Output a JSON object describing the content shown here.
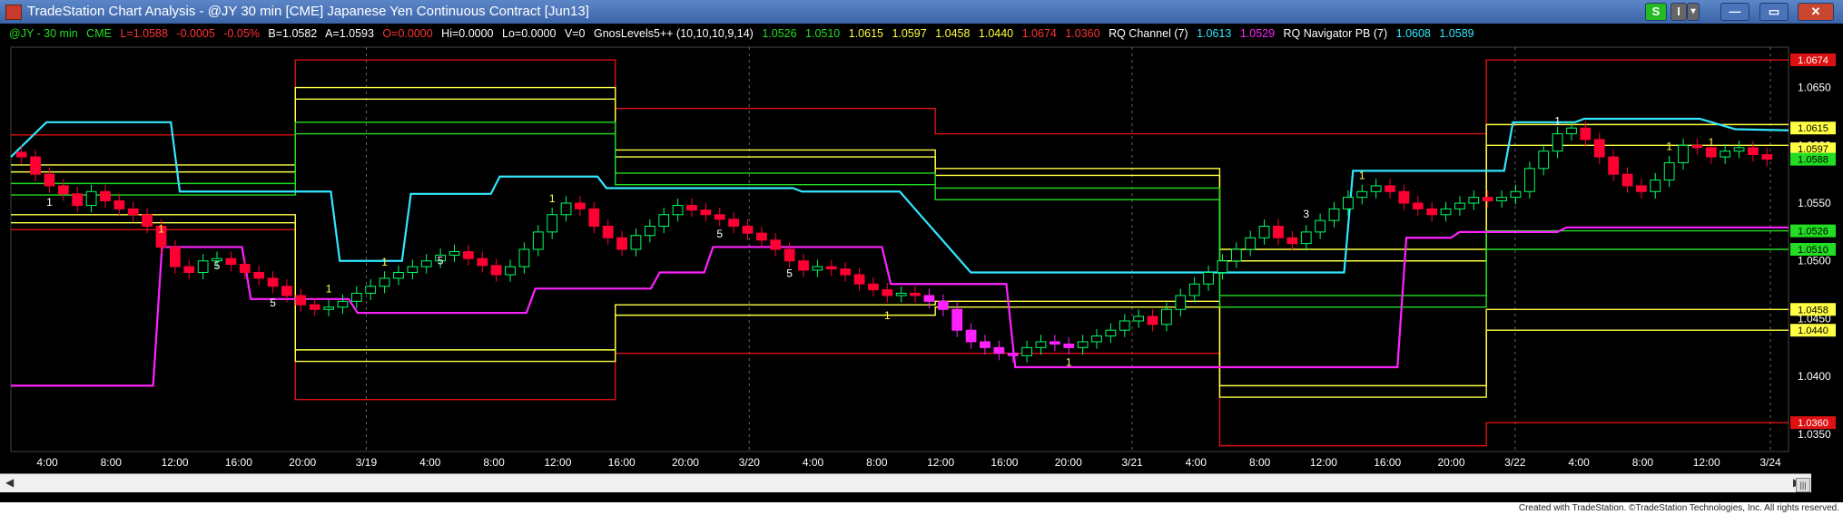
{
  "window": {
    "title": "TradeStation Chart Analysis - @JY 30 min [CME] Japanese Yen Continuous Contract [Jun13]",
    "buttons": [
      "S",
      "I",
      "▾",
      "—",
      "▭",
      "✕"
    ]
  },
  "legend": {
    "symbol": "@JY - 30 min",
    "exchange": "CME",
    "last": "L=1.0588",
    "change": "-0.0005",
    "change_pct": "-0.05%",
    "bid": "B=1.0582",
    "ask": "A=1.0593",
    "open": "O=0.0000",
    "high": "Hi=0.0000",
    "low": "Lo=0.0000",
    "volume": "V=0",
    "study1": "GnosLevels5++ (10,10,10,9,14)",
    "study1_vals": [
      "1.0526",
      "1.0510",
      "1.0615",
      "1.0597",
      "1.0458",
      "1.0440",
      "1.0674",
      "1.0360"
    ],
    "study2": "RQ  Channel (7)",
    "study2_vals": [
      "1.0613",
      "1.0529"
    ],
    "study3": "RQ Navigator PB (7)",
    "study3_vals": [
      "1.0608",
      "1.0589"
    ]
  },
  "colors": {
    "background": "#000000",
    "up_candle": "#00ff66",
    "down_candle": "#ff0033",
    "cyan": "#33e6ff",
    "magenta": "#ff22ff",
    "yellow": "#ffff44",
    "green": "#22dd22",
    "red": "#dd1111"
  },
  "chart_data": {
    "type": "candlestick",
    "x_tick_labels": [
      "4:00",
      "8:00",
      "12:00",
      "16:00",
      "20:00",
      "3/19",
      "4:00",
      "8:00",
      "12:00",
      "16:00",
      "20:00",
      "3/20",
      "4:00",
      "8:00",
      "12:00",
      "16:00",
      "20:00",
      "3/21",
      "4:00",
      "8:00",
      "12:00",
      "16:00",
      "20:00",
      "3/22",
      "4:00",
      "8:00",
      "12:00",
      "3/24"
    ],
    "y_tick_labels": [
      "1.0650",
      "1.0600",
      "1.0550",
      "1.0500",
      "1.0450",
      "1.0400",
      "1.0350"
    ],
    "ylim": [
      1.0335,
      1.0685
    ],
    "price_tags": [
      {
        "label": "1.0674",
        "value": 1.0674,
        "color": "#dd1111",
        "text": "#ffffff"
      },
      {
        "label": "1.0615",
        "value": 1.0615,
        "color": "#ffff44",
        "text": "#000000"
      },
      {
        "label": "1.0597",
        "value": 1.0597,
        "color": "#ffff44",
        "text": "#000000"
      },
      {
        "label": "1.0588",
        "value": 1.0588,
        "color": "#22dd22",
        "text": "#000000"
      },
      {
        "label": "1.0526",
        "value": 1.0526,
        "color": "#22dd22",
        "text": "#000000"
      },
      {
        "label": "1.0510",
        "value": 1.051,
        "color": "#22dd22",
        "text": "#000000"
      },
      {
        "label": "1.0458",
        "value": 1.0458,
        "color": "#ffff44",
        "text": "#000000"
      },
      {
        "label": "1.0440",
        "value": 1.044,
        "color": "#ffff44",
        "text": "#000000"
      },
      {
        "label": "1.0360",
        "value": 1.036,
        "color": "#dd1111",
        "text": "#ffffff"
      }
    ],
    "level_series": [
      {
        "color": "#dd1111",
        "segments": [
          [
            0,
            16,
            1.0609
          ],
          [
            16,
            34,
            1.0674
          ],
          [
            34,
            52,
            1.0632
          ],
          [
            52,
            68,
            1.061
          ],
          [
            68,
            83,
            1.061
          ],
          [
            83,
            100,
            1.0674
          ]
        ]
      },
      {
        "color": "#dd1111",
        "segments": [
          [
            0,
            16,
            1.0527
          ],
          [
            16,
            34,
            1.038
          ],
          [
            34,
            52,
            1.042
          ],
          [
            52,
            68,
            1.042
          ],
          [
            68,
            83,
            1.034
          ],
          [
            83,
            100,
            1.036
          ]
        ]
      },
      {
        "color": "#ffff44",
        "segments": [
          [
            0,
            16,
            1.0583
          ],
          [
            16,
            34,
            1.065
          ],
          [
            34,
            52,
            1.0596
          ],
          [
            52,
            68,
            1.058
          ],
          [
            68,
            83,
            1.051
          ],
          [
            83,
            100,
            1.0618
          ]
        ]
      },
      {
        "color": "#ffff44",
        "segments": [
          [
            0,
            16,
            1.0577
          ],
          [
            16,
            34,
            1.064
          ],
          [
            34,
            52,
            1.059
          ],
          [
            52,
            68,
            1.0574
          ],
          [
            68,
            83,
            1.05
          ],
          [
            83,
            100,
            1.06
          ]
        ]
      },
      {
        "color": "#ffff44",
        "segments": [
          [
            0,
            16,
            1.054
          ],
          [
            16,
            34,
            1.0423
          ],
          [
            34,
            52,
            1.0462
          ],
          [
            52,
            68,
            1.0465
          ],
          [
            68,
            83,
            1.0392
          ],
          [
            83,
            100,
            1.0458
          ]
        ]
      },
      {
        "color": "#ffff44",
        "segments": [
          [
            0,
            16,
            1.0533
          ],
          [
            16,
            34,
            1.0413
          ],
          [
            34,
            52,
            1.0453
          ],
          [
            52,
            68,
            1.046
          ],
          [
            68,
            83,
            1.0382
          ],
          [
            83,
            100,
            1.044
          ]
        ]
      },
      {
        "color": "#22dd22",
        "segments": [
          [
            0,
            16,
            1.0567
          ],
          [
            16,
            34,
            1.062
          ],
          [
            34,
            52,
            1.0576
          ],
          [
            52,
            68,
            1.0563
          ],
          [
            68,
            83,
            1.047
          ],
          [
            83,
            100,
            1.0526
          ]
        ]
      },
      {
        "color": "#22dd22",
        "segments": [
          [
            0,
            16,
            1.0557
          ],
          [
            16,
            34,
            1.061
          ],
          [
            34,
            52,
            1.0566
          ],
          [
            52,
            68,
            1.0553
          ],
          [
            68,
            83,
            1.046
          ],
          [
            83,
            100,
            1.051
          ]
        ]
      }
    ],
    "channel_upper": [
      [
        0,
        1.059
      ],
      [
        2,
        1.062
      ],
      [
        9,
        1.062
      ],
      [
        9.5,
        1.056
      ],
      [
        18,
        1.056
      ],
      [
        18.5,
        1.05
      ],
      [
        22,
        1.05
      ],
      [
        22.5,
        1.0558
      ],
      [
        27,
        1.0558
      ],
      [
        27.5,
        1.0573
      ],
      [
        33,
        1.0573
      ],
      [
        33.5,
        1.0563
      ],
      [
        44,
        1.0563
      ],
      [
        44.5,
        1.056
      ],
      [
        50,
        1.056
      ],
      [
        54,
        1.049
      ],
      [
        75,
        1.049
      ],
      [
        75.5,
        1.0578
      ],
      [
        84,
        1.0578
      ],
      [
        84.5,
        1.062
      ],
      [
        88,
        1.062
      ],
      [
        88.5,
        1.0623
      ],
      [
        95,
        1.0623
      ],
      [
        97,
        1.0614
      ],
      [
        100,
        1.0613
      ]
    ],
    "channel_lower": [
      [
        0,
        1.058
      ],
      [
        2,
        1.058
      ],
      [
        2.5,
        1.058
      ]
    ],
    "navigator": [
      [
        0,
        1.0392
      ],
      [
        8,
        1.0392
      ],
      [
        8.5,
        1.0512
      ],
      [
        13,
        1.0512
      ],
      [
        13.5,
        1.0467
      ],
      [
        19,
        1.0467
      ],
      [
        19.5,
        1.0455
      ],
      [
        29,
        1.0455
      ],
      [
        29.5,
        1.0476
      ],
      [
        36,
        1.0476
      ],
      [
        36.5,
        1.049
      ],
      [
        39,
        1.049
      ],
      [
        39.5,
        1.0512
      ],
      [
        49,
        1.0512
      ],
      [
        49.5,
        1.048
      ],
      [
        56,
        1.048
      ],
      [
        56.5,
        1.0408
      ],
      [
        78,
        1.0408
      ],
      [
        78.5,
        1.052
      ],
      [
        81,
        1.052
      ],
      [
        81.5,
        1.0525
      ],
      [
        87,
        1.0525
      ],
      [
        87.5,
        1.0529
      ],
      [
        100,
        1.0529
      ]
    ],
    "candles_close": [
      1.059,
      1.0575,
      1.0565,
      1.0558,
      1.0548,
      1.056,
      1.0552,
      1.0545,
      1.054,
      1.053,
      1.0512,
      1.0495,
      1.049,
      1.05,
      1.0502,
      1.0497,
      1.049,
      1.0485,
      1.0478,
      1.047,
      1.0462,
      1.0458,
      1.046,
      1.0465,
      1.0472,
      1.0478,
      1.0485,
      1.049,
      1.0495,
      1.05,
      1.0505,
      1.0508,
      1.0502,
      1.0496,
      1.0488,
      1.0495,
      1.051,
      1.0525,
      1.054,
      1.055,
      1.0545,
      1.053,
      1.052,
      1.051,
      1.0522,
      1.053,
      1.054,
      1.0548,
      1.0544,
      1.054,
      1.0536,
      1.053,
      1.0524,
      1.0518,
      1.051,
      1.05,
      1.0492,
      1.0495,
      1.0493,
      1.0488,
      1.048,
      1.0475,
      1.047,
      1.0472,
      1.047,
      1.0465,
      1.0458,
      1.044,
      1.043,
      1.0425,
      1.042,
      1.0418,
      1.0425,
      1.043,
      1.0428,
      1.0425,
      1.043,
      1.0435,
      1.044,
      1.0448,
      1.0452,
      1.0445,
      1.0458,
      1.047,
      1.048,
      1.049,
      1.05,
      1.051,
      1.052,
      1.053,
      1.052,
      1.0515,
      1.0525,
      1.0535,
      1.0545,
      1.0555,
      1.056,
      1.0565,
      1.056,
      1.055,
      1.0545,
      1.054,
      1.0545,
      1.055,
      1.0555,
      1.0552,
      1.0555,
      1.056,
      1.058,
      1.0595,
      1.061,
      1.0615,
      1.0605,
      1.059,
      1.0575,
      1.0565,
      1.056,
      1.057,
      1.0585,
      1.06,
      1.0598,
      1.059,
      1.0595,
      1.0598,
      1.0592,
      1.0588
    ],
    "annotations": [
      {
        "text": "1",
        "i": 2,
        "color": "#ffffff",
        "dy": 22
      },
      {
        "text": "1",
        "i": 10,
        "color": "#ffff44",
        "dy": -16
      },
      {
        "text": "5",
        "i": 14,
        "color": "#ffffff",
        "dy": 12
      },
      {
        "text": "5",
        "i": 18,
        "color": "#ffffff",
        "dy": 22
      },
      {
        "text": "1",
        "i": 22,
        "color": "#ffff44",
        "dy": -16
      },
      {
        "text": "1",
        "i": 26,
        "color": "#ffff44",
        "dy": -14
      },
      {
        "text": "5",
        "i": 30,
        "color": "#ffffff",
        "dy": 10
      },
      {
        "text": "1",
        "i": 38,
        "color": "#ffff44",
        "dy": -14
      },
      {
        "text": "5",
        "i": 50,
        "color": "#ffffff",
        "dy": 20
      },
      {
        "text": "5",
        "i": 55,
        "color": "#ffffff",
        "dy": 18
      },
      {
        "text": "1",
        "i": 62,
        "color": "#ffff44",
        "dy": 26
      },
      {
        "text": "1",
        "i": 75,
        "color": "#ffff44",
        "dy": 20
      },
      {
        "text": "3",
        "i": 92,
        "color": "#ffffff",
        "dy": -16
      },
      {
        "text": "1",
        "i": 96,
        "color": "#ffff44",
        "dy": -14
      },
      {
        "text": "1",
        "i": 110,
        "color": "#ffffff",
        "dy": -10
      },
      {
        "text": "1",
        "i": 118,
        "color": "#ffff44",
        "dy": -14
      },
      {
        "text": "1",
        "i": 121,
        "color": "#ffff44",
        "dy": -12
      }
    ]
  },
  "footer": {
    "credit": "Created with TradeStation. ©TradeStation Technologies, Inc. All rights reserved."
  }
}
